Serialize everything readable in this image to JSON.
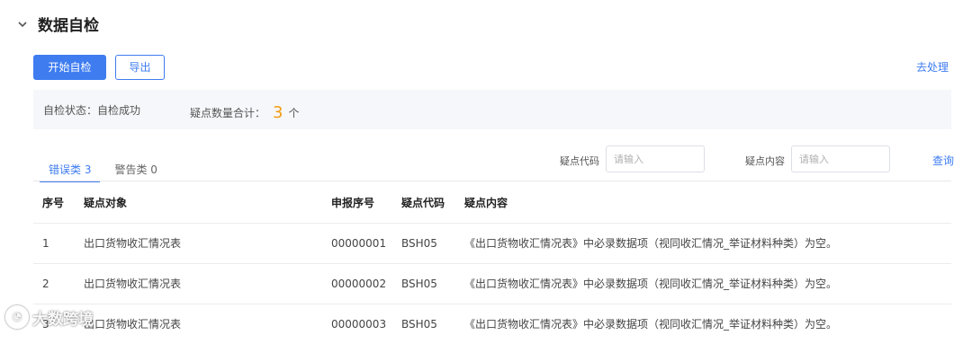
{
  "section": {
    "title": "数据自检",
    "chevron_icon": "chevron-down-icon"
  },
  "toolbar": {
    "start_label": "开始自检",
    "export_label": "导出",
    "process_label": "去处理"
  },
  "status": {
    "state_label": "自检状态：",
    "state_value": "自检成功",
    "count_label": "疑点数量合计：",
    "count_value": "3",
    "count_unit": "个",
    "count_color": "#f39c12"
  },
  "tabs": [
    {
      "label": "错误类 3",
      "active": true
    },
    {
      "label": "警告类 0",
      "active": false
    }
  ],
  "filters": {
    "code_label": "疑点代码",
    "code_placeholder": "请输入",
    "content_label": "疑点内容",
    "content_placeholder": "请输入",
    "query_label": "查询"
  },
  "table": {
    "headers": [
      "序号",
      "疑点对象",
      "申报序号",
      "疑点代码",
      "疑点内容"
    ],
    "rows": [
      [
        "1",
        "出口货物收汇情况表",
        "00000001",
        "BSH05",
        "《出口货物收汇情况表》中必录数据项（视同收汇情况_举证材料种类）为空。"
      ],
      [
        "2",
        "出口货物收汇情况表",
        "00000002",
        "BSH05",
        "《出口货物收汇情况表》中必录数据项（视同收汇情况_举证材料种类）为空。"
      ],
      [
        "3",
        "出口货物收汇情况表",
        "00000003",
        "BSH05",
        "《出口货物收汇情况表》中必录数据项（视同收汇情况_举证材料种类）为空。"
      ]
    ]
  },
  "watermark": {
    "text": "大数跨境"
  },
  "colors": {
    "accent": "#3e7cf0",
    "status_bg": "#f5f7fa"
  }
}
